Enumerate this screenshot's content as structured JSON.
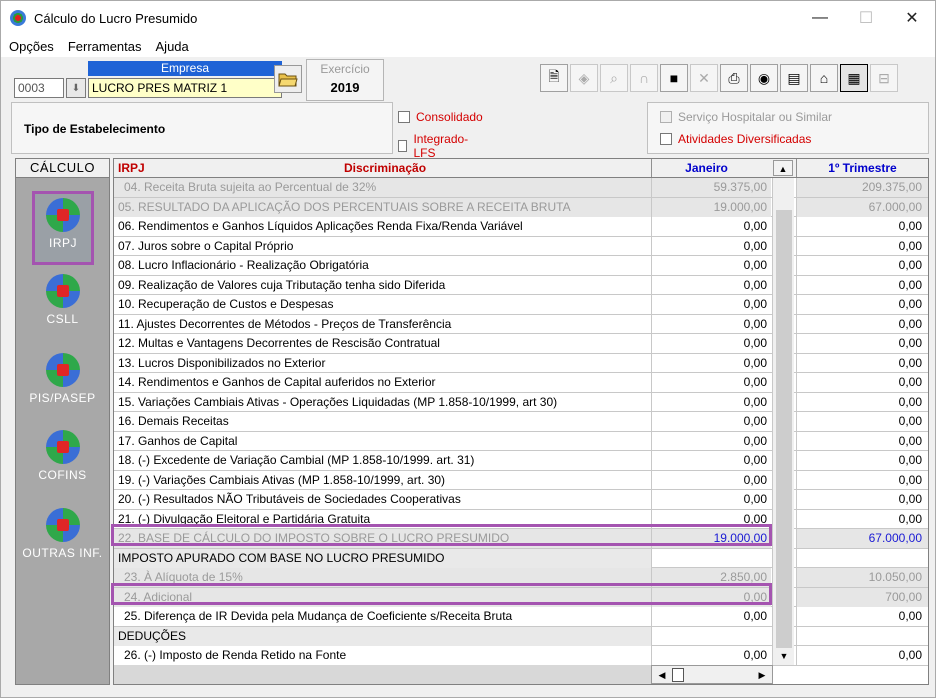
{
  "window": {
    "title": "Cálculo do Lucro Presumido",
    "minimize": "—",
    "maximize": "☐",
    "close": "✕"
  },
  "menu": [
    "Opções",
    "Ferramentas",
    "Ajuda"
  ],
  "empresa": {
    "label": "Empresa",
    "code": "0003",
    "name": "LUCRO  PRES MATRIZ 1"
  },
  "exercicio": {
    "label": "Exercício",
    "value": "2019"
  },
  "tipo": {
    "label": "Tipo de Estabelecimento",
    "consolidado": "Consolidado",
    "integrado": "Integrado-LFS",
    "servico": "Serviço Hospitalar ou Similar",
    "atividades": "Atividades Diversificadas"
  },
  "sidebar": {
    "header": "CÁLCULO",
    "items": [
      "IRPJ",
      "CSLL",
      "PIS/PASEP",
      "COFINS",
      "OUTRAS INF."
    ]
  },
  "grid": {
    "headers": {
      "tab": "IRPJ",
      "discriminacao": "Discriminação",
      "janeiro": "Janeiro",
      "trimestre": "1º Trimestre"
    },
    "rows": [
      {
        "d": "04. Receita Bruta sujeita ao Percentual de 32%",
        "j": "59.375,00",
        "t": "209.375,00",
        "style": "gray",
        "ind": true
      },
      {
        "d": "05. RESULTADO DA APLICAÇÃO DOS PERCENTUAIS SOBRE A RECEITA BRUTA",
        "j": "19.000,00",
        "t": "67.000,00",
        "style": "gray"
      },
      {
        "d": "06. Rendimentos e Ganhos Líquidos Aplicações Renda Fixa/Renda Variável",
        "j": "0,00",
        "t": "0,00"
      },
      {
        "d": "07. Juros sobre o Capital Próprio",
        "j": "0,00",
        "t": "0,00"
      },
      {
        "d": "08. Lucro Inflacionário - Realização Obrigatória",
        "j": "0,00",
        "t": "0,00"
      },
      {
        "d": "09. Realização de Valores cuja Tributação tenha sido Diferida",
        "j": "0,00",
        "t": "0,00"
      },
      {
        "d": "10. Recuperação de Custos e Despesas",
        "j": "0,00",
        "t": "0,00"
      },
      {
        "d": "11. Ajustes Decorrentes de Métodos - Preços de Transferência",
        "j": "0,00",
        "t": "0,00"
      },
      {
        "d": "12. Multas e Vantagens Decorrentes de Rescisão Contratual",
        "j": "0,00",
        "t": "0,00"
      },
      {
        "d": "13. Lucros Disponibilizados no Exterior",
        "j": "0,00",
        "t": "0,00"
      },
      {
        "d": "14. Rendimentos e Ganhos de Capital auferidos no Exterior",
        "j": "0,00",
        "t": "0,00"
      },
      {
        "d": "15. Variações Cambiais Ativas - Operações Liquidadas (MP 1.858-10/1999, art 30)",
        "j": "0,00",
        "t": "0,00"
      },
      {
        "d": "16. Demais Receitas",
        "j": "0,00",
        "t": "0,00"
      },
      {
        "d": "17. Ganhos de Capital",
        "j": "0,00",
        "t": "0,00"
      },
      {
        "d": "18. (-) Excedente de Variação Cambial (MP 1.858-10/1999. art. 31)",
        "j": "0,00",
        "t": "0,00"
      },
      {
        "d": "19. (-) Variações Cambiais Ativas (MP 1.858-10/1999, art. 30)",
        "j": "0,00",
        "t": "0,00"
      },
      {
        "d": "20. (-) Resultados NÃO Tributáveis de Sociedades Cooperativas",
        "j": "0,00",
        "t": "0,00"
      },
      {
        "d": "21. (-) Divulgação Eleitoral e Partidária Gratuita",
        "j": "0,00",
        "t": "0,00"
      },
      {
        "d": "22. BASE DE CÁLCULO DO IMPOSTO SOBRE O LUCRO PRESUMIDO",
        "j": "19.000,00",
        "t": "67.000,00",
        "style": "gray",
        "blue": true
      },
      {
        "d": "IMPOSTO APURADO COM BASE NO LUCRO PRESUMIDO",
        "j": "",
        "t": "",
        "style": "sect"
      },
      {
        "d": "23. À Alíquota de 15%",
        "j": "2.850,00",
        "t": "10.050,00",
        "style": "gray",
        "ind": true
      },
      {
        "d": "24. Adicional",
        "j": "0,00",
        "t": "700,00",
        "style": "gray",
        "ind": true
      },
      {
        "d": "25. Diferença de IR Devida pela Mudança de Coeficiente s/Receita Bruta",
        "j": "0,00",
        "t": "0,00",
        "ind": true
      },
      {
        "d": "DEDUÇÕES",
        "j": "",
        "t": "",
        "style": "sect"
      },
      {
        "d": "26. (-) Imposto de Renda Retido na Fonte",
        "j": "0,00",
        "t": "0,00",
        "ind": true
      }
    ]
  },
  "colors": {
    "highlight": "#a454b0",
    "accent": "#1f63d6",
    "red_label": "#d40000"
  }
}
